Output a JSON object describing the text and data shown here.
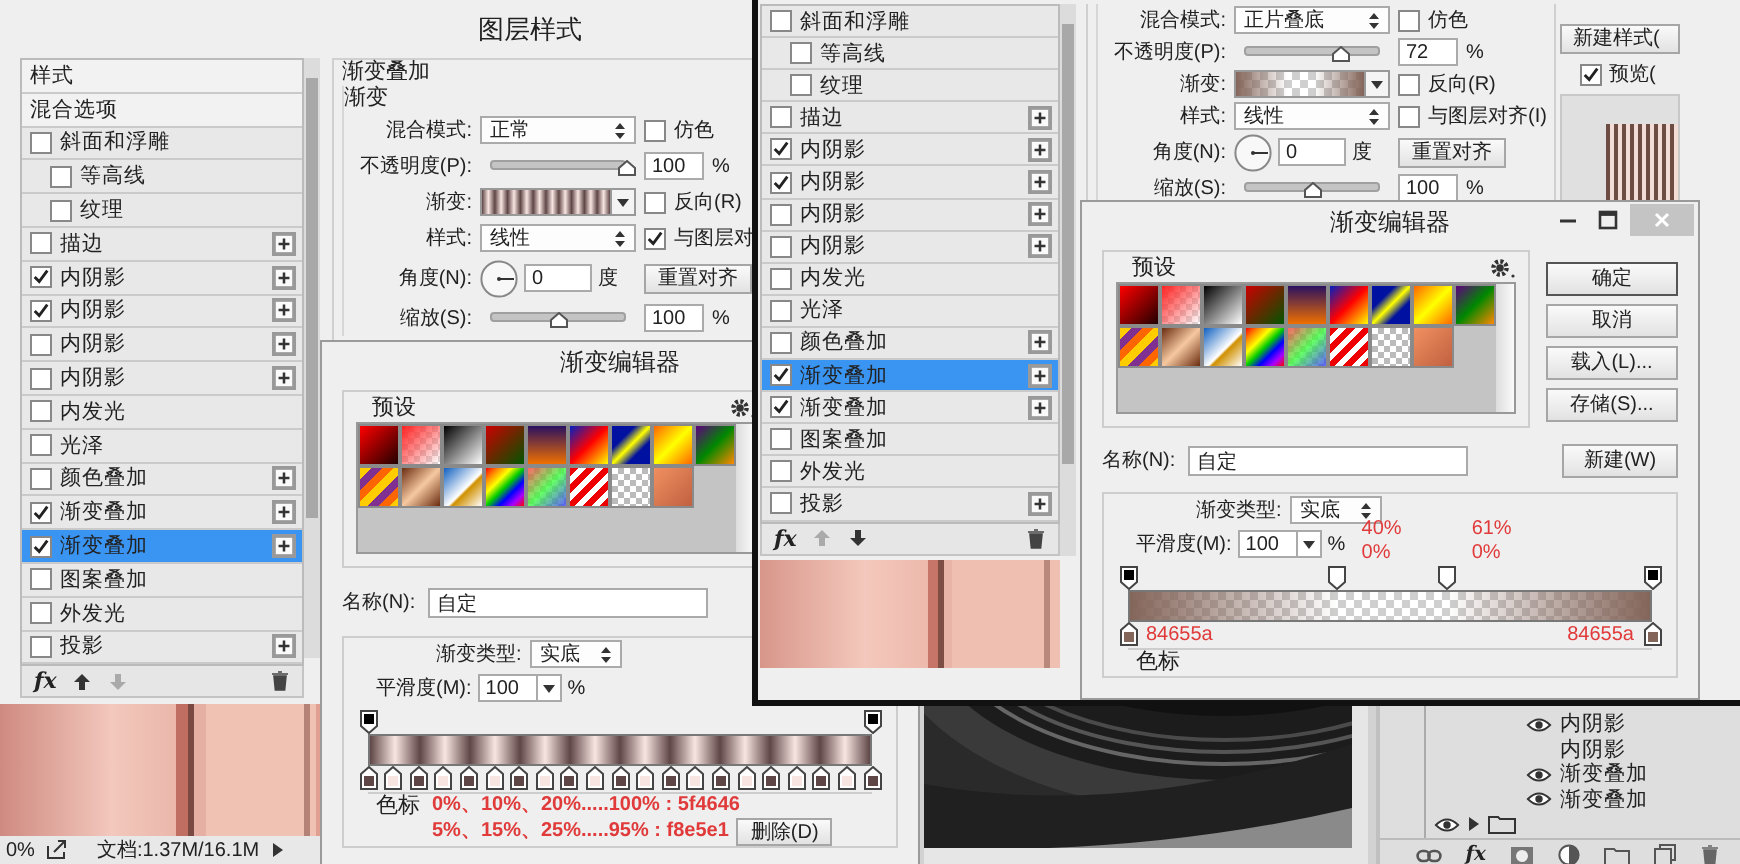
{
  "layer_style_dialogs": [
    {
      "title": "图层样式",
      "list": [
        {
          "kind": "plain",
          "label": "样式",
          "selected": false
        },
        {
          "kind": "plain",
          "label": "混合选项",
          "selected": false
        },
        {
          "kind": "effect",
          "label": "斜面和浮雕",
          "checked": false,
          "selected": false,
          "add": false,
          "children": [
            {
              "kind": "effect",
              "label": "等高线",
              "checked": false,
              "selected": false,
              "add": false
            },
            {
              "kind": "effect",
              "label": "纹理",
              "checked": false,
              "selected": false,
              "add": false
            }
          ]
        },
        {
          "kind": "effect",
          "label": "描边",
          "checked": false,
          "selected": false,
          "add": true
        },
        {
          "kind": "effect",
          "label": "内阴影",
          "checked": true,
          "selected": false,
          "add": true
        },
        {
          "kind": "effect",
          "label": "内阴影",
          "checked": true,
          "selected": false,
          "add": true
        },
        {
          "kind": "effect",
          "label": "内阴影",
          "checked": false,
          "selected": false,
          "add": true
        },
        {
          "kind": "effect",
          "label": "内阴影",
          "checked": false,
          "selected": false,
          "add": true
        },
        {
          "kind": "effect",
          "label": "内发光",
          "checked": false,
          "selected": false,
          "add": false
        },
        {
          "kind": "effect",
          "label": "光泽",
          "checked": false,
          "selected": false,
          "add": false
        },
        {
          "kind": "effect",
          "label": "颜色叠加",
          "checked": false,
          "selected": false,
          "add": true
        },
        {
          "kind": "effect",
          "label": "渐变叠加",
          "checked": true,
          "selected": false,
          "add": true
        },
        {
          "kind": "effect",
          "label": "渐变叠加",
          "checked": true,
          "selected": true,
          "add": true
        },
        {
          "kind": "effect",
          "label": "图案叠加",
          "checked": false,
          "selected": false,
          "add": false
        },
        {
          "kind": "effect",
          "label": "外发光",
          "checked": false,
          "selected": false,
          "add": false
        },
        {
          "kind": "effect",
          "label": "投影",
          "checked": false,
          "selected": false,
          "add": true
        }
      ],
      "footer": {
        "fx": "fx",
        "up_disabled": false,
        "down_disabled": true
      },
      "panel": {
        "section": "渐变叠加",
        "group": "渐变",
        "blend": {
          "label": "混合模式:",
          "value": "正常"
        },
        "dither": {
          "label": "仿色",
          "checked": false
        },
        "opacity": {
          "label": "不透明度(P):",
          "level": 1,
          "value": "100",
          "unit": "%"
        },
        "gradient_label": "渐变:",
        "reverse": {
          "label": "反向(R)",
          "checked": false
        },
        "style": {
          "label": "样式:",
          "value": "线性"
        },
        "align": {
          "label": "与图层对",
          "checked": true
        },
        "angle": {
          "label": "角度(N):",
          "value": "0",
          "unit": "度"
        },
        "reset_button": "重置对齐",
        "scale": {
          "label": "缩放(S):",
          "level": 0.5,
          "value": "100",
          "unit": "%"
        }
      }
    },
    {
      "list": [
        {
          "kind": "effect",
          "label": "斜面和浮雕",
          "checked": false,
          "selected": false,
          "add": false,
          "children": [
            {
              "kind": "effect",
              "label": "等高线",
              "checked": false,
              "selected": false,
              "add": false
            },
            {
              "kind": "effect",
              "label": "纹理",
              "checked": false,
              "selected": false,
              "add": false
            }
          ]
        },
        {
          "kind": "effect",
          "label": "描边",
          "checked": false,
          "selected": false,
          "add": true
        },
        {
          "kind": "effect",
          "label": "内阴影",
          "checked": true,
          "selected": false,
          "add": true
        },
        {
          "kind": "effect",
          "label": "内阴影",
          "checked": true,
          "selected": false,
          "add": true
        },
        {
          "kind": "effect",
          "label": "内阴影",
          "checked": false,
          "selected": false,
          "add": true
        },
        {
          "kind": "effect",
          "label": "内阴影",
          "checked": false,
          "selected": false,
          "add": true
        },
        {
          "kind": "effect",
          "label": "内发光",
          "checked": false,
          "selected": false,
          "add": false
        },
        {
          "kind": "effect",
          "label": "光泽",
          "checked": false,
          "selected": false,
          "add": false
        },
        {
          "kind": "effect",
          "label": "颜色叠加",
          "checked": false,
          "selected": false,
          "add": true
        },
        {
          "kind": "effect",
          "label": "渐变叠加",
          "checked": true,
          "selected": true,
          "add": true
        },
        {
          "kind": "effect",
          "label": "渐变叠加",
          "checked": true,
          "selected": false,
          "add": true
        },
        {
          "kind": "effect",
          "label": "图案叠加",
          "checked": false,
          "selected": false,
          "add": false
        },
        {
          "kind": "effect",
          "label": "外发光",
          "checked": false,
          "selected": false,
          "add": false
        },
        {
          "kind": "effect",
          "label": "投影",
          "checked": false,
          "selected": false,
          "add": true
        }
      ],
      "footer": {
        "fx": "fx",
        "up_disabled": true,
        "down_disabled": false
      },
      "panel": {
        "blend": {
          "label": "混合模式:",
          "value": "正片叠底"
        },
        "dither": {
          "label": "仿色",
          "checked": false
        },
        "opacity": {
          "label": "不透明度(P):",
          "level": 0.72,
          "value": "72",
          "unit": "%"
        },
        "gradient_label": "渐变:",
        "reverse": {
          "label": "反向(R)",
          "checked": false
        },
        "style": {
          "label": "样式:",
          "value": "线性"
        },
        "align": {
          "label": "与图层对齐(I)",
          "checked": false
        },
        "angle": {
          "label": "角度(N):",
          "value": "0",
          "unit": "度"
        },
        "reset_button": "重置对齐",
        "scale": {
          "label": "缩放(S):",
          "level": 0.5,
          "value": "100",
          "unit": "%"
        }
      },
      "side": {
        "new_style_button": "新建样式(",
        "preview": {
          "label": "预览(",
          "checked": true
        }
      }
    }
  ],
  "gradient_editors": [
    {
      "title": "渐变编辑器",
      "presets_label": "预设",
      "name_label": "名称(N):",
      "name_value": "自定",
      "type_label": "渐变类型:",
      "type_value": "实底",
      "smooth_label": "平滑度(M):",
      "smooth_value": "100",
      "smooth_unit": "%",
      "opacity_stops": [
        {
          "level": 0,
          "color": "#000000"
        },
        {
          "level": 1,
          "color": "#000000"
        }
      ],
      "color_stops": [
        {
          "level": 0,
          "color": "#5f4646"
        },
        {
          "level": 0.05,
          "color": "#f8e5e1"
        },
        {
          "level": 0.1,
          "color": "#5f4646"
        },
        {
          "level": 0.15,
          "color": "#f8e5e1"
        },
        {
          "level": 0.2,
          "color": "#5f4646"
        },
        {
          "level": 0.25,
          "color": "#f8e5e1"
        },
        {
          "level": 0.3,
          "color": "#5f4646"
        },
        {
          "level": 0.35,
          "color": "#f8e5e1"
        },
        {
          "level": 0.4,
          "color": "#5f4646"
        },
        {
          "level": 0.45,
          "color": "#f8e5e1"
        },
        {
          "level": 0.5,
          "color": "#5f4646"
        },
        {
          "level": 0.55,
          "color": "#f8e5e1"
        },
        {
          "level": 0.6,
          "color": "#5f4646"
        },
        {
          "level": 0.65,
          "color": "#f8e5e1"
        },
        {
          "level": 0.7,
          "color": "#5f4646"
        },
        {
          "level": 0.75,
          "color": "#f8e5e1"
        },
        {
          "level": 0.8,
          "color": "#5f4646"
        },
        {
          "level": 0.85,
          "color": "#f8e5e1"
        },
        {
          "level": 0.9,
          "color": "#5f4646"
        },
        {
          "level": 0.95,
          "color": "#f8e5e1"
        },
        {
          "level": 1,
          "color": "#5f4646"
        }
      ],
      "stops_label": "色标",
      "notes": [
        "0%、10%、20%.....100% : 5f4646",
        "5%、15%、25%.....95% : f8e5e1"
      ],
      "delete_button": "删除(D)"
    },
    {
      "title": "渐变编辑器",
      "window_buttons": [
        {
          "kind": "minimize"
        },
        {
          "kind": "maximize"
        },
        {
          "kind": "close"
        }
      ],
      "presets_label": "预设",
      "buttons": [
        "确定",
        "取消",
        "载入(L)...",
        "存储(S)..."
      ],
      "name_label": "名称(N):",
      "name_value": "自定",
      "new_button": "新建(W)",
      "type_label": "渐变类型:",
      "type_value": "实底",
      "smooth_label": "平滑度(M):",
      "smooth_value": "100",
      "smooth_unit": "%",
      "opacity_stops": [
        {
          "level": 0,
          "color": "#000000"
        },
        {
          "level": 0.4,
          "color": "#ffffff",
          "notes": [
            "40%",
            "0%"
          ]
        },
        {
          "level": 0.61,
          "color": "#ffffff",
          "notes": [
            "61%",
            "0%"
          ]
        },
        {
          "level": 1,
          "color": "#000000"
        }
      ],
      "color_stops": [
        {
          "level": 0,
          "color": "#84655a",
          "note": "84655a"
        },
        {
          "level": 1,
          "color": "#84655a",
          "note": "84655a"
        }
      ],
      "stops_label": "色标"
    }
  ],
  "status_bar": {
    "zoom": "0%",
    "document": "文档:1.37M/16.1M"
  },
  "layers_panel": {
    "rows": [
      {
        "kind": "effect",
        "label": "内阴影",
        "visible": true
      },
      {
        "kind": "effect",
        "label": "内阴影",
        "visible": false
      },
      {
        "kind": "effect",
        "label": "渐变叠加",
        "visible": true
      },
      {
        "kind": "effect",
        "label": "渐变叠加",
        "visible": true
      },
      {
        "kind": "group",
        "visible": true
      }
    ],
    "toolbar_fx": "fx"
  }
}
